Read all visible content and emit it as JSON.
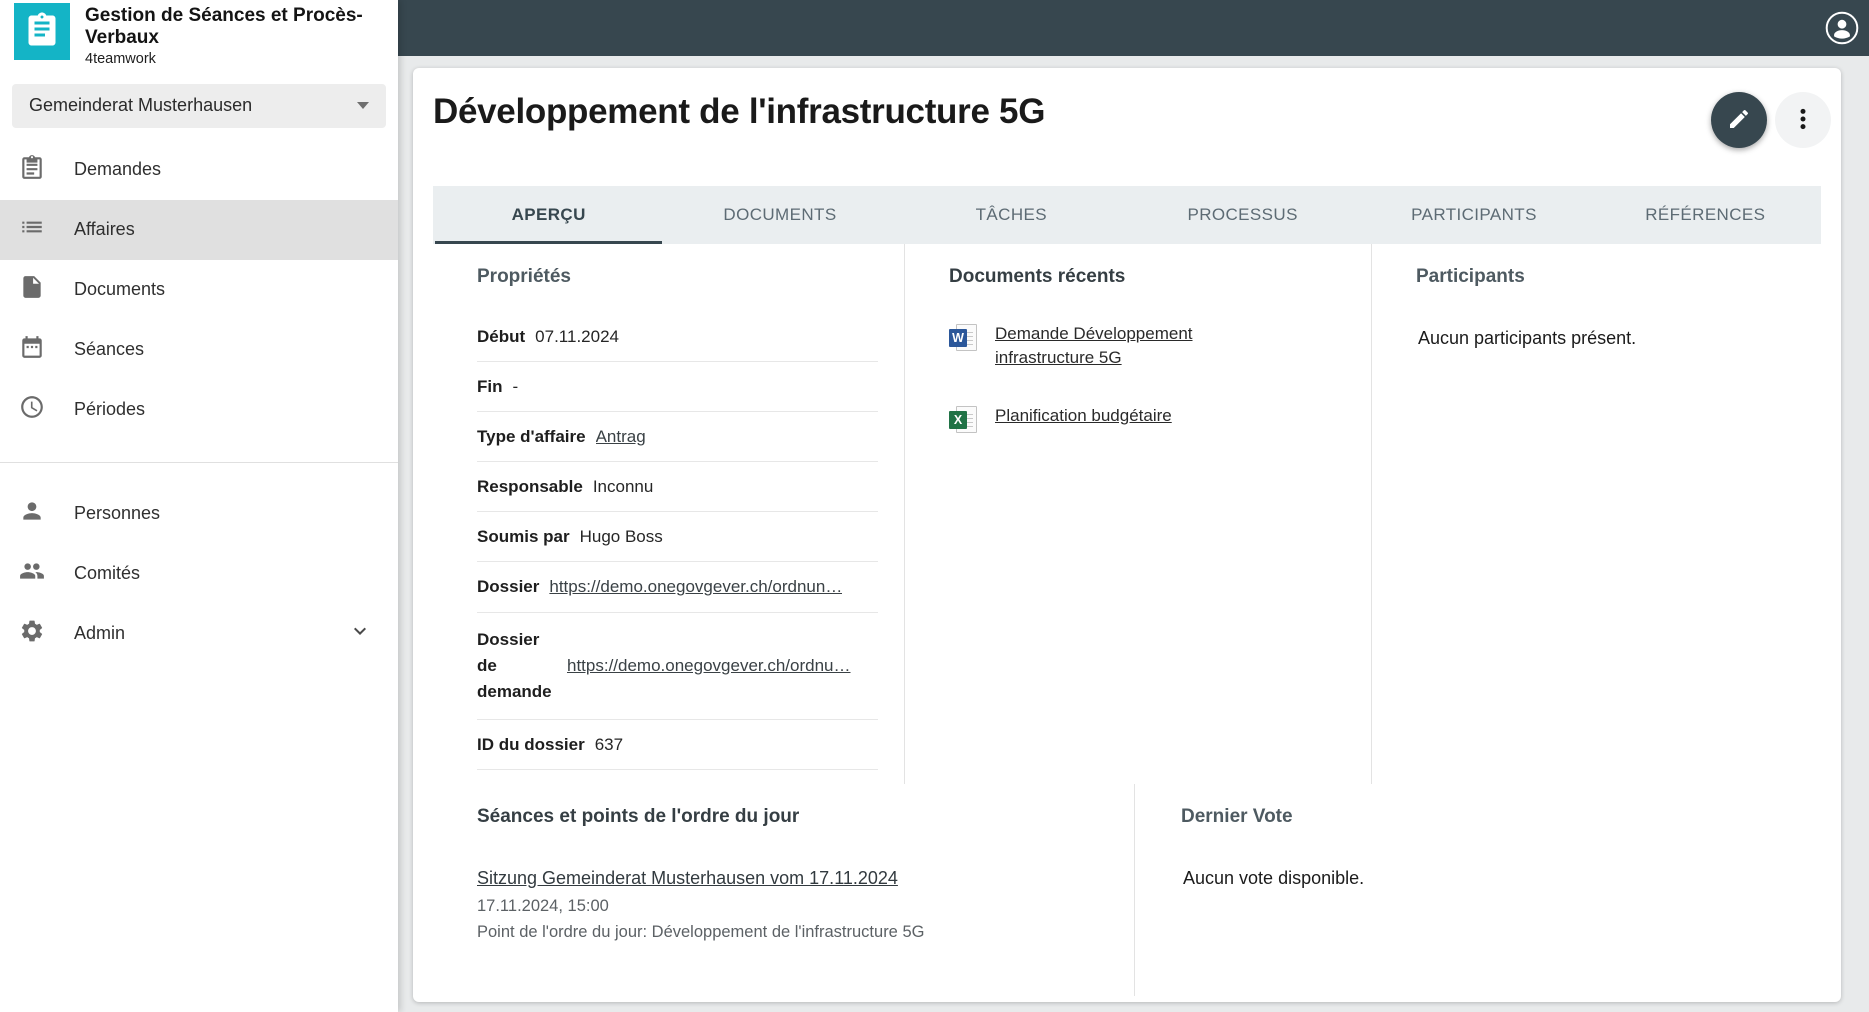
{
  "app": {
    "title": "Gestion de Séances et Procès-Verbaux",
    "subtitle": "4teamwork"
  },
  "sidebar": {
    "committee_selector": "Gemeinderat Musterhausen",
    "items": [
      {
        "label": "Demandes"
      },
      {
        "label": "Affaires",
        "active": true
      },
      {
        "label": "Documents"
      },
      {
        "label": "Séances"
      },
      {
        "label": "Périodes"
      },
      {
        "label": "Personnes"
      },
      {
        "label": "Comités"
      },
      {
        "label": "Admin"
      }
    ]
  },
  "page": {
    "title": "Développement de l'infrastructure 5G"
  },
  "tabs": [
    {
      "label": "APERÇU",
      "active": true
    },
    {
      "label": "DOCUMENTS"
    },
    {
      "label": "TÂCHES"
    },
    {
      "label": "PROCESSUS"
    },
    {
      "label": "PARTICIPANTS"
    },
    {
      "label": "RÉFÉRENCES"
    }
  ],
  "properties": {
    "heading": "Propriétés",
    "rows": [
      {
        "label": "Début",
        "value": "07.11.2024"
      },
      {
        "label": "Fin",
        "value": "-"
      },
      {
        "label": "Type d'affaire",
        "value": "Antrag"
      },
      {
        "label": "Responsable",
        "value": "Inconnu"
      },
      {
        "label": "Soumis par",
        "value": "Hugo Boss"
      },
      {
        "label": "Dossier",
        "value": "https://demo.onegovgever.ch/ordnun…"
      },
      {
        "label": "Dossier de demande",
        "value": "https://demo.onegovgever.ch/ordnu…"
      },
      {
        "label": "ID du dossier",
        "value": "637"
      }
    ]
  },
  "recent_documents": {
    "heading": "Documents récents",
    "items": [
      {
        "kind": "word",
        "badge": "W",
        "label": "Demande Développement infrastructure 5G"
      },
      {
        "kind": "excel",
        "badge": "X",
        "label": "Planification budgétaire"
      }
    ]
  },
  "participants": {
    "heading": "Participants",
    "empty_text": "Aucun participants présent."
  },
  "meetings": {
    "heading": "Séances et points de l'ordre du jour",
    "link": "Sitzung Gemeinderat Musterhausen vom 17.11.2024",
    "datetime": "17.11.2024, 15:00",
    "agenda_item": "Point de l'ordre du jour: Développement de l'infrastructure 5G"
  },
  "last_vote": {
    "heading": "Dernier Vote",
    "empty_text": "Aucun vote disponible."
  },
  "colors": {
    "brand_accent": "#14b4c6",
    "topbar": "#37474f",
    "selected_item_bg": "#e0e0e0",
    "word_icon": "#2b579a",
    "excel_icon": "#217346"
  }
}
